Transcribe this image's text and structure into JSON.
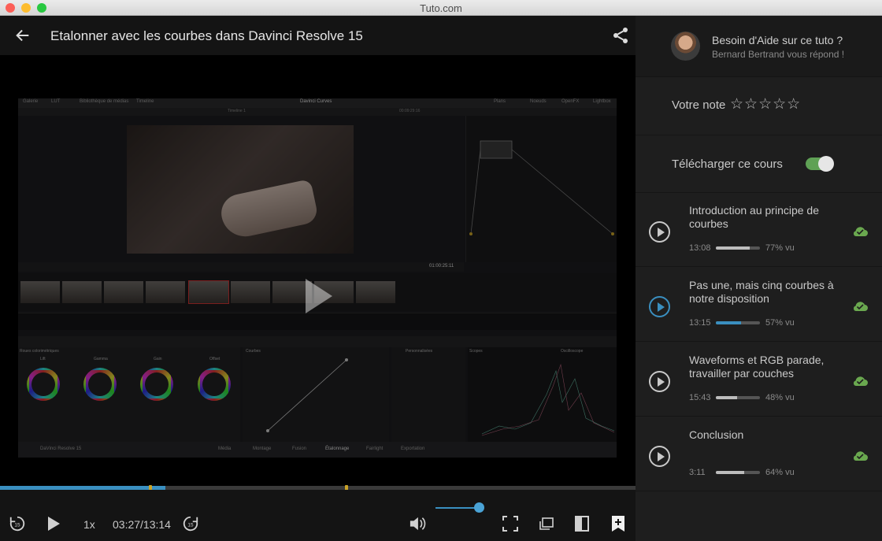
{
  "window": {
    "title": "Tuto.com"
  },
  "header": {
    "course_title": "Etalonner avec les courbes dans Davinci Resolve 15"
  },
  "video": {
    "app_title": "Davinci Curves",
    "timeline_label": "Timeline 1",
    "timecode": "00:09:29:16",
    "clip_timecode": "01:00:25:11",
    "tabs": [
      "Galerie",
      "LUT",
      "Bibliothèque de médias",
      "Timeline"
    ],
    "right_tabs": [
      "Plans",
      "Noeuds",
      "OpenFX",
      "Lightbox"
    ],
    "panel_labels": [
      "Roues colorimétriques",
      "Courbes",
      "Personnalisées",
      "Scopes",
      "Oscilloscope"
    ],
    "wheel_labels": [
      "Lift",
      "Gamma",
      "Gain",
      "Offset"
    ],
    "bottom_pages": [
      "Média",
      "Montage",
      "Fusion",
      "Étalonnage",
      "Fairlight",
      "Exportation"
    ],
    "app_name": "DaVinci Resolve 15"
  },
  "player": {
    "progress_fraction": 0.26,
    "speed": "1x",
    "time": "03:27/13:14",
    "rewind_label": "15",
    "forward_label": "15",
    "volume_fraction": 1.0
  },
  "help": {
    "title": "Besoin d'Aide sur ce tuto ?",
    "subtitle": "Bernard Bertrand vous répond !"
  },
  "rating": {
    "label": "Votre note",
    "stars": "☆☆☆☆☆"
  },
  "download": {
    "label": "Télécharger ce cours",
    "enabled": true
  },
  "lessons": [
    {
      "title": "Introduction au principe de courbes",
      "duration": "13:08",
      "progress": 0.77,
      "pct_label": "77% vu",
      "active": false
    },
    {
      "title": "Pas une, mais cinq courbes à notre disposition",
      "duration": "13:15",
      "progress": 0.57,
      "pct_label": "57% vu",
      "active": true
    },
    {
      "title": "Waveforms et RGB parade, travailler par couches",
      "duration": "15:43",
      "progress": 0.48,
      "pct_label": "48% vu",
      "active": false
    },
    {
      "title": "Conclusion",
      "duration": "3:11",
      "progress": 0.64,
      "pct_label": "64% vu",
      "active": false
    }
  ],
  "colors": {
    "accent": "#3a8fc0",
    "toggle": "#5fa155",
    "cloud": "#6aa84f",
    "marker": "#c9a227"
  }
}
